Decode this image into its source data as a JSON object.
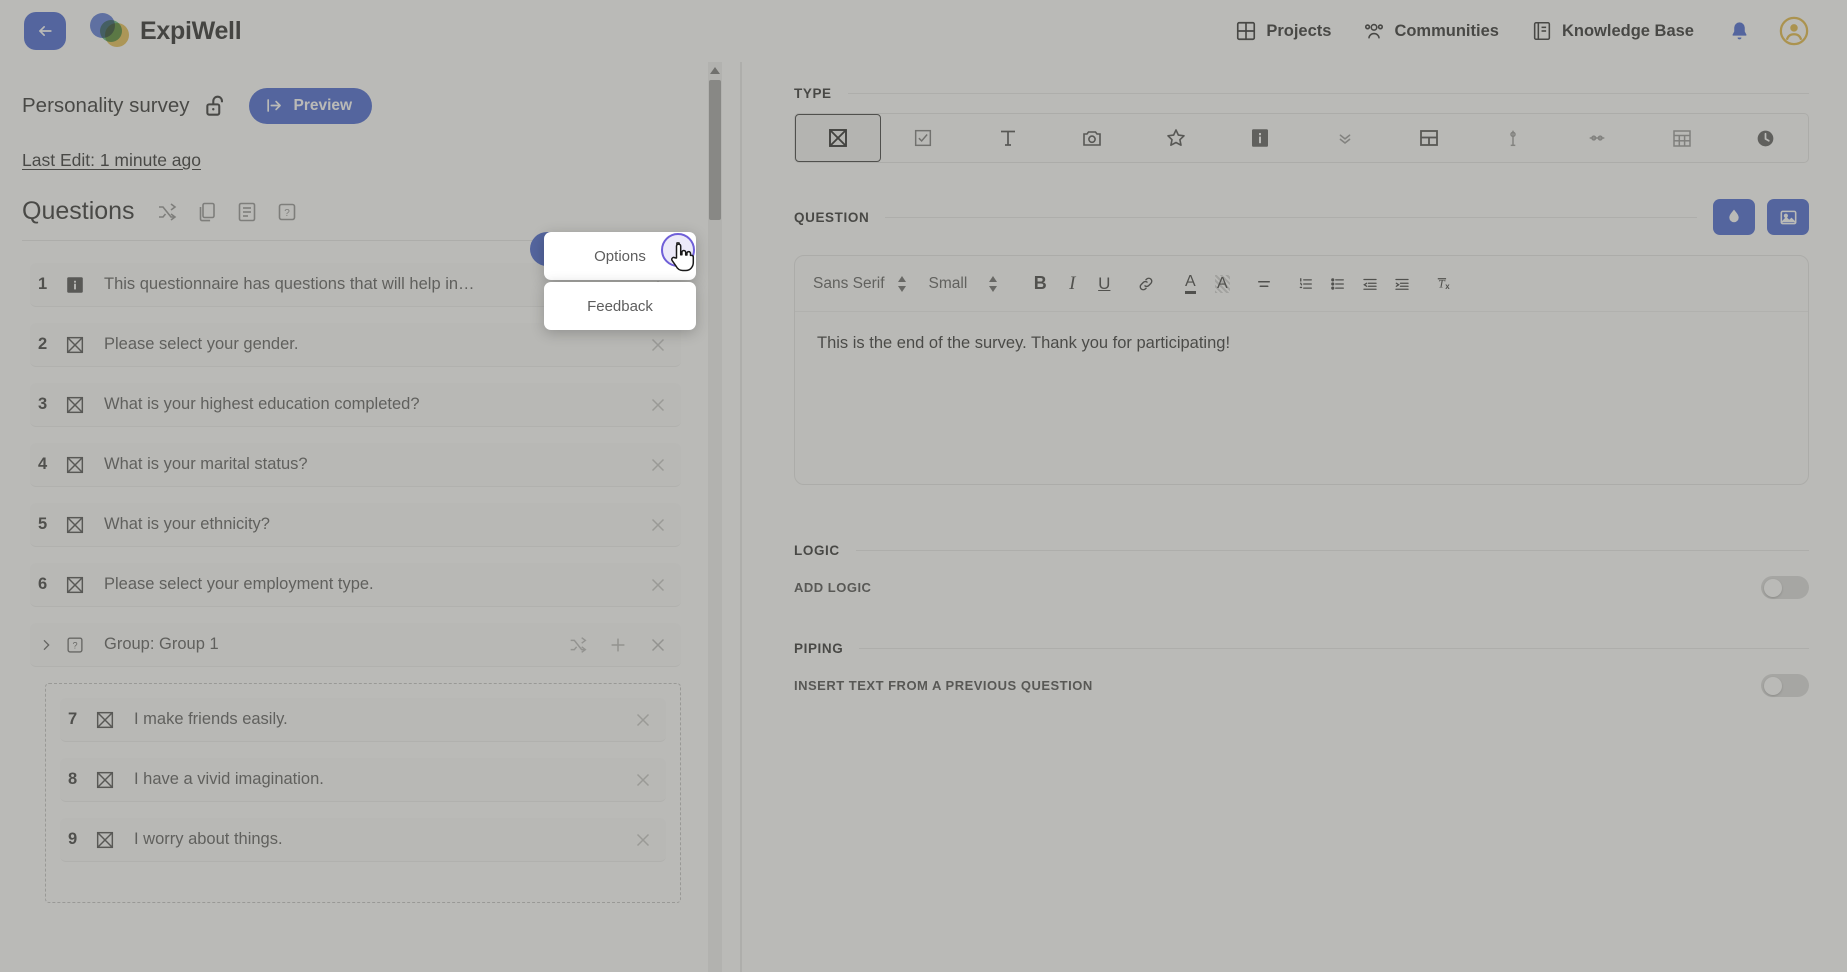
{
  "app": {
    "brand_name": "ExpiWell",
    "back_icon": "back-arrow-icon",
    "logo_icon": "expiwell-logo-icon"
  },
  "topnav": {
    "items": [
      {
        "label": "Projects",
        "icon": "grid-icon"
      },
      {
        "label": "Communities",
        "icon": "people-group-icon"
      },
      {
        "label": "Knowledge Base",
        "icon": "book-icon"
      }
    ],
    "bell_icon": "notification-bell-icon",
    "avatar_icon": "user-avatar-icon",
    "accent_blue": "#3355cc",
    "avatar_gold": "#e0b02e"
  },
  "left": {
    "survey_title": "Personality survey",
    "lock_icon": "unlocked-padlock-icon",
    "preview_label": "Preview",
    "preview_icon": "preview-arrow-icon",
    "last_edit": "Last Edit: 1 minute ago",
    "questions_heading": "Questions",
    "header_icons": [
      {
        "name": "shuffle-icon"
      },
      {
        "name": "duplicate-icon"
      },
      {
        "name": "notes-icon"
      },
      {
        "name": "help-icon"
      }
    ],
    "questions": [
      {
        "num": "1",
        "text": "This questionnaire has questions that will help in…",
        "type_icon": "info-filled-icon",
        "action_icon": "chevron-up-icon"
      },
      {
        "num": "2",
        "text": "Please select your gender.",
        "type_icon": "single-select-icon",
        "action_icon": "close-icon"
      },
      {
        "num": "3",
        "text": "What is your highest education completed?",
        "type_icon": "single-select-icon",
        "action_icon": "close-icon"
      },
      {
        "num": "4",
        "text": "What is your marital status?",
        "type_icon": "single-select-icon",
        "action_icon": "close-icon"
      },
      {
        "num": "5",
        "text": "What is your ethnicity?",
        "type_icon": "single-select-icon",
        "action_icon": "close-icon"
      },
      {
        "num": "6",
        "text": "Please select your employment type.",
        "type_icon": "single-select-icon",
        "action_icon": "close-icon"
      }
    ],
    "group": {
      "caret_icon": "chevron-right-icon",
      "icon": "help-icon",
      "label": "Group: Group 1",
      "actions": [
        {
          "name": "shuffle-icon"
        },
        {
          "name": "plus-icon"
        },
        {
          "name": "close-icon"
        }
      ],
      "questions": [
        {
          "num": "7",
          "text": "I make friends easily.",
          "type_icon": "single-select-icon",
          "action_icon": "close-icon"
        },
        {
          "num": "8",
          "text": "I have a vivid imagination.",
          "type_icon": "single-select-icon",
          "action_icon": "close-icon"
        },
        {
          "num": "9",
          "text": "I worry about things.",
          "type_icon": "single-select-icon",
          "action_icon": "close-icon"
        }
      ]
    }
  },
  "dropdown": {
    "options_label": "Options",
    "feedback_label": "Feedback",
    "trigger_icon": "three-dots-vertical-icon",
    "cursor_icon": "pointing-hand-cursor"
  },
  "right": {
    "type_label": "TYPE",
    "type_icons": [
      {
        "name": "single-select-icon",
        "selected": true
      },
      {
        "name": "checkbox-icon",
        "selected": false
      },
      {
        "name": "text-input-icon",
        "selected": false
      },
      {
        "name": "camera-icon",
        "selected": false
      },
      {
        "name": "star-rating-icon",
        "selected": false
      },
      {
        "name": "info-filled-icon",
        "selected": false
      },
      {
        "name": "dropdown-icon",
        "selected": false
      },
      {
        "name": "matrix-grid-icon",
        "selected": false
      },
      {
        "name": "vertical-slider-icon",
        "selected": false
      },
      {
        "name": "horizontal-slider-icon",
        "selected": false
      },
      {
        "name": "calendar-grid-icon",
        "selected": false
      },
      {
        "name": "clock-icon",
        "selected": false
      }
    ],
    "question_label": "QUESTION",
    "question_actions": [
      {
        "name": "ink-droplet-icon"
      },
      {
        "name": "image-icon"
      }
    ],
    "editor": {
      "font_family_value": "Sans Serif",
      "font_size_value": "Small",
      "toolbar_buttons": [
        {
          "name": "bold-icon",
          "glyph": "B"
        },
        {
          "name": "italic-icon",
          "glyph": "I"
        },
        {
          "name": "underline-icon",
          "glyph": "U"
        },
        {
          "name": "link-icon",
          "glyph": ""
        },
        {
          "name": "text-color-icon",
          "glyph": "A"
        },
        {
          "name": "highlight-color-icon",
          "glyph": "A"
        },
        {
          "name": "align-icon",
          "glyph": ""
        },
        {
          "name": "ordered-list-icon",
          "glyph": ""
        },
        {
          "name": "bullet-list-icon",
          "glyph": ""
        },
        {
          "name": "outdent-icon",
          "glyph": ""
        },
        {
          "name": "indent-icon",
          "glyph": ""
        },
        {
          "name": "clear-format-icon",
          "glyph": ""
        }
      ],
      "body_text": "This is the end of the survey. Thank you for participating!"
    },
    "logic": {
      "section_label": "LOGIC",
      "toggle_label": "ADD LOGIC",
      "toggle_state": "off"
    },
    "piping": {
      "section_label": "PIPING",
      "toggle_label": "INSERT TEXT FROM A PREVIOUS QUESTION",
      "toggle_state": "off"
    }
  }
}
